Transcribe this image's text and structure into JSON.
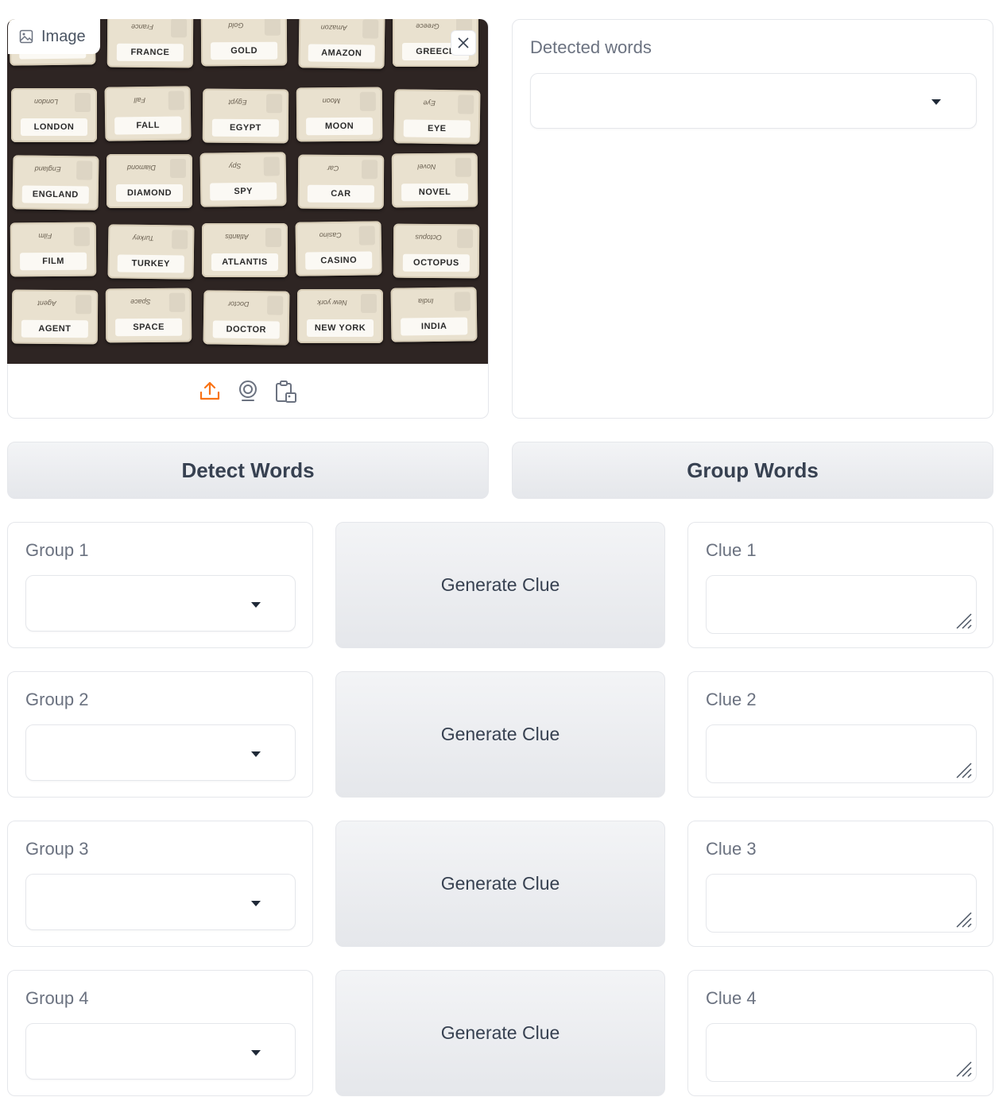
{
  "image_panel": {
    "label": "Image",
    "cards": [
      [
        "SUIT",
        "FRANCE",
        "GOLD",
        "AMAZON",
        "GREECE"
      ],
      [
        "LONDON",
        "FALL",
        "EGYPT",
        "MOON",
        "EYE"
      ],
      [
        "ENGLAND",
        "DIAMOND",
        "SPY",
        "CAR",
        "NOVEL"
      ],
      [
        "FILM",
        "TURKEY",
        "ATLANTIS",
        "CASINO",
        "OCTOPUS"
      ],
      [
        "AGENT",
        "SPACE",
        "DOCTOR",
        "NEW YORK",
        "INDIA"
      ]
    ],
    "icons": [
      "image-icon",
      "close-icon",
      "upload-icon",
      "webcam-icon",
      "clipboard-icon"
    ]
  },
  "detected_words": {
    "label": "Detected words",
    "value": ""
  },
  "buttons": {
    "detect": "Detect Words",
    "group": "Group Words"
  },
  "rows": [
    {
      "group_label": "Group 1",
      "group_value": "",
      "generate": "Generate Clue",
      "clue_label": "Clue 1",
      "clue_value": ""
    },
    {
      "group_label": "Group 2",
      "group_value": "",
      "generate": "Generate Clue",
      "clue_label": "Clue 2",
      "clue_value": ""
    },
    {
      "group_label": "Group 3",
      "group_value": "",
      "generate": "Generate Clue",
      "clue_label": "Clue 3",
      "clue_value": ""
    },
    {
      "group_label": "Group 4",
      "group_value": "",
      "generate": "Generate Clue",
      "clue_label": "Clue 4",
      "clue_value": ""
    }
  ],
  "colors": {
    "accent": "#f97316",
    "button_bg": "#e5e7eb",
    "border": "#e5e7eb",
    "label": "#6b7280"
  }
}
